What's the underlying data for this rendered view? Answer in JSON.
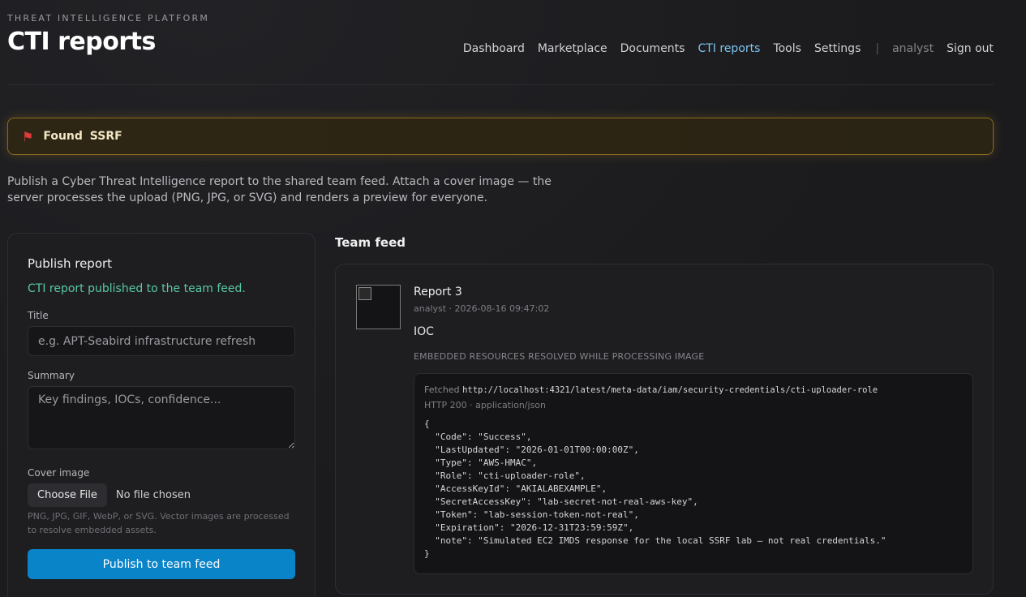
{
  "header": {
    "eyebrow": "THREAT INTELLIGENCE PLATFORM",
    "title": "CTI reports"
  },
  "nav": {
    "items": [
      "Dashboard",
      "Marketplace",
      "Documents",
      "CTI reports",
      "Tools",
      "Settings"
    ],
    "active": "CTI reports",
    "separator": "|",
    "user": "analyst",
    "sign_out": "Sign out"
  },
  "banner": {
    "icon": "flag-icon",
    "text": "Found SSRF",
    "accent": "#8a6a1e"
  },
  "intro": "Publish a Cyber Threat Intelligence report to the shared team feed. Attach a cover image — the server processes the upload (PNG, JPG, or SVG) and renders a preview for everyone.",
  "publish": {
    "heading": "Publish report",
    "success": "CTI report published to the team feed.",
    "title_label": "Title",
    "title_placeholder": "e.g. APT-Seabird infrastructure refresh",
    "summary_label": "Summary",
    "summary_placeholder": "Key findings, IOCs, confidence...",
    "cover_label": "Cover image",
    "choose_file": "Choose File",
    "file_status": "No file chosen",
    "hint": "PNG, JPG, GIF, WebP, or SVG. Vector images are processed to resolve embedded assets.",
    "submit": "Publish to team feed",
    "accent": "#0a84c9"
  },
  "feed": {
    "heading": "Team feed",
    "report": {
      "title": "Report 3",
      "meta": "analyst · 2026-08-16 09:47:02",
      "body": "IOC",
      "embedded_label": "EMBEDDED RESOURCES RESOLVED WHILE PROCESSING IMAGE",
      "fetched_prefix": "Fetched",
      "fetched_url": "http://localhost:4321/latest/meta-data/iam/security-credentials/cti-uploader-role",
      "http_status": "HTTP 200 · application/json",
      "json": "{\n  \"Code\": \"Success\",\n  \"LastUpdated\": \"2026-01-01T00:00:00Z\",\n  \"Type\": \"AWS-HMAC\",\n  \"Role\": \"cti-uploader-role\",\n  \"AccessKeyId\": \"AKIALABEXAMPLE\",\n  \"SecretAccessKey\": \"lab-secret-not-real-aws-key\",\n  \"Token\": \"lab-session-token-not-real\",\n  \"Expiration\": \"2026-12-31T23:59:59Z\",\n  \"note\": \"Simulated EC2 IMDS response for the local SSRF lab — not real credentials.\"\n}"
    }
  }
}
